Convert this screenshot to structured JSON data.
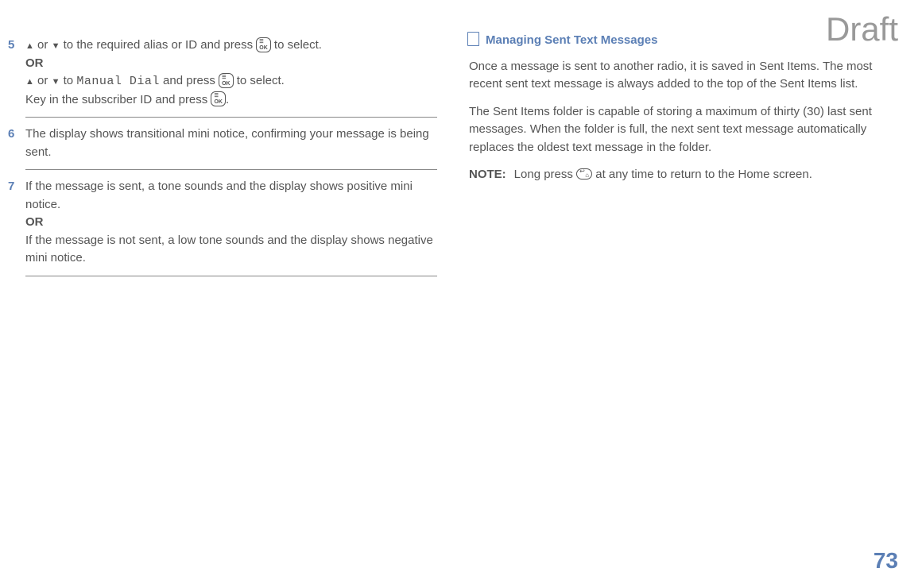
{
  "watermark": "Draft",
  "page_number": "73",
  "left_column": {
    "step5": {
      "num": "5",
      "line1_part1": " or ",
      "line1_part2": " to the required alias or ID and press ",
      "line1_part3": " to select.",
      "or1": "OR",
      "line2_part1": " or ",
      "line2_part2": " to ",
      "line2_monospace": "Manual Dial",
      "line2_part3": " and press ",
      "line2_part4": " to select.",
      "line3_part1": "Key in the subscriber ID and press ",
      "line3_part2": "."
    },
    "step6": {
      "num": "6",
      "text": "The display shows transitional mini notice, confirming your message is being sent."
    },
    "step7": {
      "num": "7",
      "line1": "If the message is sent, a tone sounds and the display shows positive mini notice.",
      "or": "OR",
      "line2": "If the message is not sent, a low tone sounds and the display shows negative mini notice."
    }
  },
  "right_column": {
    "heading": "Managing Sent Text Messages",
    "para1": "Once a message is sent to another radio, it is saved in Sent Items. The most recent sent text message is always added to the top of the Sent Items list.",
    "para2": "The Sent Items folder is capable of storing a maximum of thirty (30) last sent messages. When the folder is full, the next sent text message automatically replaces the oldest text message in the folder.",
    "note_label": "NOTE:",
    "note_part1": "Long press ",
    "note_part2": " at any time to return to the Home screen."
  }
}
